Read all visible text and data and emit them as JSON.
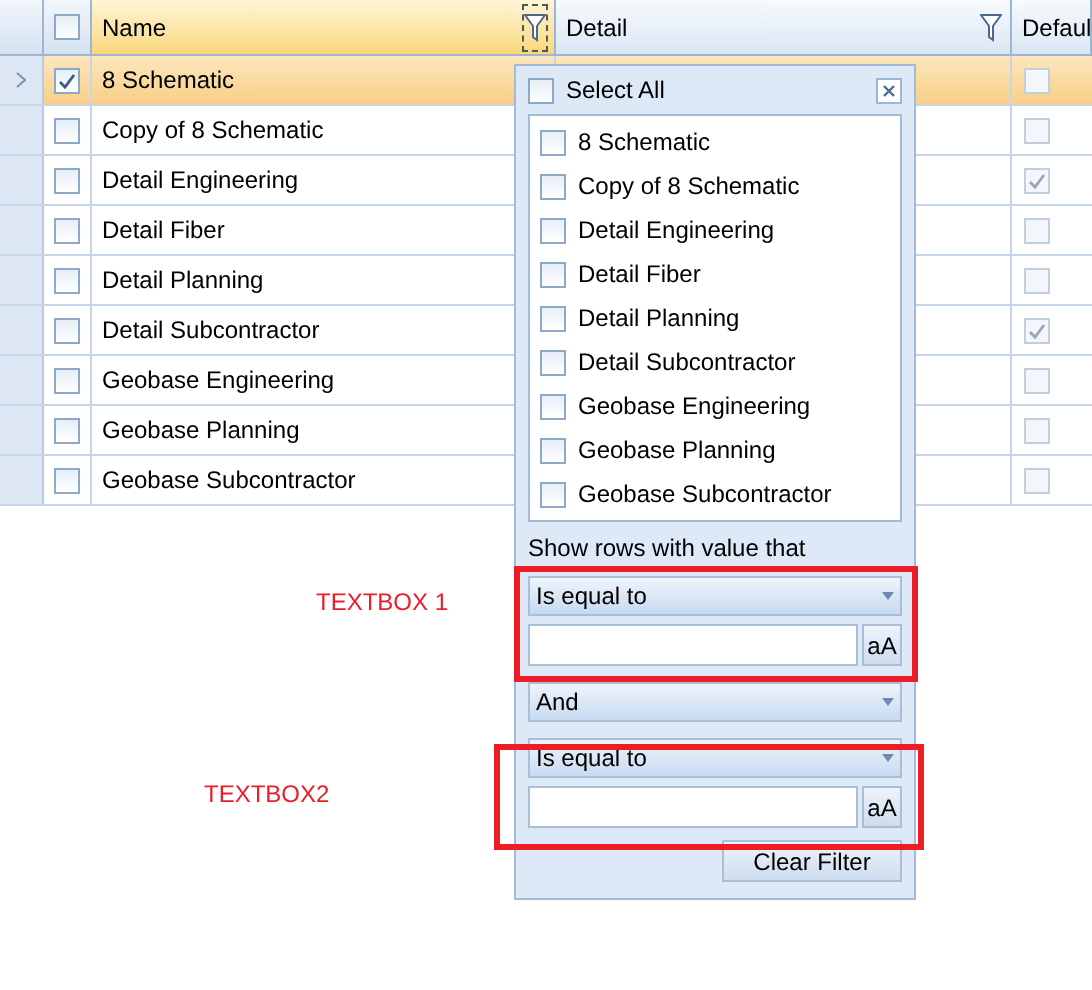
{
  "grid": {
    "header_checkbox": {
      "checked": false
    },
    "columns": [
      {
        "label": "Name",
        "filterable": true,
        "active": true
      },
      {
        "label": "Detail",
        "filterable": true,
        "active": false
      },
      {
        "label": "Defaul",
        "active": false
      }
    ],
    "rows": [
      {
        "name": "8 Schematic",
        "selected": true,
        "checked": true,
        "default": false
      },
      {
        "name": "Copy of 8 Schematic",
        "selected": false,
        "checked": false,
        "default": false
      },
      {
        "name": "Detail Engineering",
        "selected": false,
        "checked": false,
        "default": true
      },
      {
        "name": "Detail Fiber",
        "selected": false,
        "checked": false,
        "default": false
      },
      {
        "name": "Detail Planning",
        "selected": false,
        "checked": false,
        "default": false
      },
      {
        "name": "Detail Subcontractor",
        "selected": false,
        "checked": false,
        "default": true
      },
      {
        "name": "Geobase Engineering",
        "selected": false,
        "checked": false,
        "default": false
      },
      {
        "name": "Geobase Planning",
        "selected": false,
        "checked": false,
        "default": false
      },
      {
        "name": "Geobase Subcontractor",
        "selected": false,
        "checked": false,
        "default": false
      }
    ]
  },
  "filter_popup": {
    "select_all": {
      "label": "Select All",
      "checked": false
    },
    "items": [
      {
        "label": "8 Schematic",
        "checked": false
      },
      {
        "label": "Copy of 8 Schematic",
        "checked": false
      },
      {
        "label": "Detail Engineering",
        "checked": false
      },
      {
        "label": "Detail Fiber",
        "checked": false
      },
      {
        "label": "Detail Planning",
        "checked": false
      },
      {
        "label": "Detail Subcontractor",
        "checked": false
      },
      {
        "label": "Geobase Engineering",
        "checked": false
      },
      {
        "label": "Geobase Planning",
        "checked": false
      },
      {
        "label": "Geobase Subcontractor",
        "checked": false
      }
    ],
    "prompt": "Show rows with value that",
    "condition_1": "Is equal to",
    "case_button_1": "aA",
    "logic": "And",
    "condition_2": "Is equal to",
    "case_button_2": "aA",
    "clear_button": "Clear Filter"
  },
  "annotations": [
    {
      "label": "TEXTBOX 1"
    },
    {
      "label": "TEXTBOX2"
    }
  ]
}
